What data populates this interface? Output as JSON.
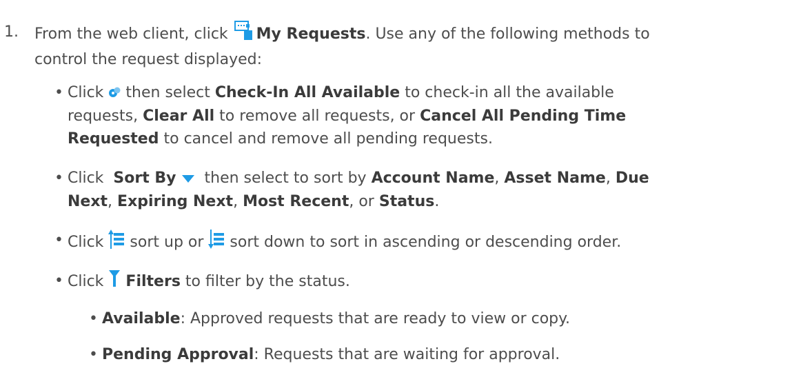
{
  "step": {
    "number": "1.",
    "intro_pre": "From the web client, click",
    "intro_bold": "My Requests",
    "intro_post": ". Use any of the following methods to",
    "intro_line2": "control the request displayed:"
  },
  "bullets": [
    {
      "pre": "Click",
      "mid1": "then select",
      "b1": "Check-In All Available",
      "t1": "to check-in all the available",
      "t2": "requests,",
      "b2": "Clear All",
      "t3": "to remove all requests, or",
      "b3": "Cancel All Pending Time",
      "b3b": "Requested",
      "t4": "to cancel and remove all pending requests."
    },
    {
      "pre": "Click",
      "b1": "Sort By",
      "t1": "then select to sort by",
      "b2": "Account Name",
      "sep1": ",",
      "b3": "Asset Name",
      "sep2": ",",
      "b4": "Due",
      "b4b": "Next",
      "sep3": ",",
      "b5": "Expiring Next",
      "sep4": ",",
      "b6": "Most Recent",
      "sep5": ", or",
      "b7": "Status",
      "end": "."
    },
    {
      "pre": "Click",
      "t1": "sort up or",
      "t2": "sort down to sort in ascending or descending order."
    },
    {
      "pre": "Click",
      "b1": "Filters",
      "t1": "to filter by the status."
    }
  ],
  "sub_items": [
    {
      "label": "Available",
      "text": ": Approved requests that are ready to view or copy."
    },
    {
      "label": "Pending Approval",
      "text": ": Requests that are waiting for approval."
    }
  ],
  "icons": {
    "my_requests": "my-requests-icon",
    "actions": "actions-icon",
    "sort_by": "triangle-down-icon",
    "sort_up": "sort-up-icon",
    "sort_down": "sort-down-icon",
    "filter": "filter-icon"
  },
  "colors": {
    "text": "#4d4d4d",
    "bold": "#3b3b3b",
    "icon_blue": "#1e9be5",
    "icon_light": "#7cc4f0"
  }
}
